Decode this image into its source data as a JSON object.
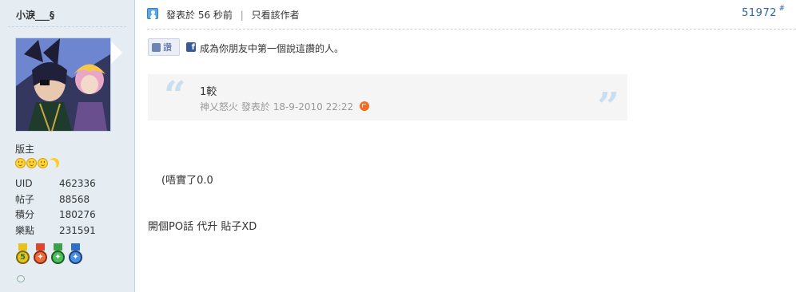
{
  "author": {
    "username": "小淚___§",
    "rank": "版主",
    "stats": [
      {
        "label": "UID",
        "value": "462336"
      },
      {
        "label": "帖子",
        "value": "88568"
      },
      {
        "label": "積分",
        "value": "180276"
      },
      {
        "label": "樂點",
        "value": "231591"
      }
    ],
    "medals": [
      {
        "icon": "medal-5-icon",
        "glyph": "5",
        "color": "#e8c31d"
      },
      {
        "icon": "medal-red-icon",
        "glyph": "✦",
        "color": "#e0452f"
      },
      {
        "icon": "medal-green-icon",
        "glyph": "✦",
        "color": "#3aa14a"
      },
      {
        "icon": "medal-blue-icon",
        "glyph": "✦",
        "color": "#2f6fc9"
      }
    ]
  },
  "post": {
    "posted_prefix": "發表於",
    "posted_time": "56 秒前",
    "separator": "|",
    "only_author": "只看該作者",
    "floor": "51972",
    "floor_hash": "#"
  },
  "like": {
    "button_label": "讚",
    "fb_letter": "f",
    "text": "成為你朋友中第一個說這讚的人。"
  },
  "quote": {
    "text": "1較",
    "author": "神乂怒火",
    "posted_prefix": "發表於",
    "date": "18-9-2010 22:22"
  },
  "body": {
    "line1": "(唔實了0.0",
    "line2": "開個PO話 代升 貼子XD"
  },
  "colors": {
    "sidebar_bg": "#e5edf2",
    "link": "#336699",
    "quote_bg": "#f5f5f5",
    "quote_mark": "#c9dff0"
  }
}
